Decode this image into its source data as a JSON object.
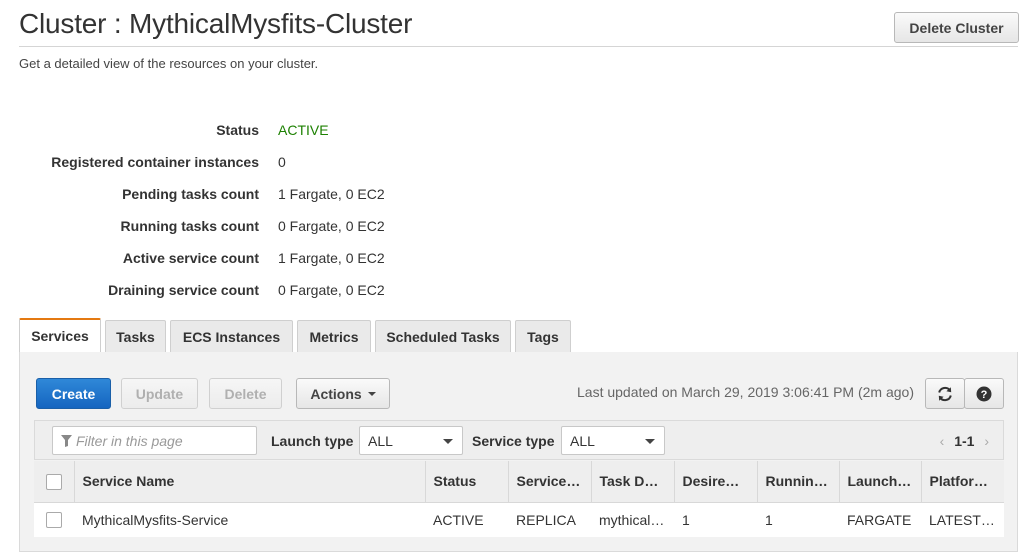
{
  "header": {
    "title": "Cluster : MythicalMysfits-Cluster",
    "subtitle": "Get a detailed view of the resources on your cluster.",
    "delete_button": "Delete Cluster"
  },
  "details": [
    {
      "label": "Status",
      "value": "ACTIVE"
    },
    {
      "label": "Registered container instances",
      "value": "0"
    },
    {
      "label": "Pending tasks count",
      "value": "1 Fargate, 0 EC2"
    },
    {
      "label": "Running tasks count",
      "value": "0 Fargate, 0 EC2"
    },
    {
      "label": "Active service count",
      "value": "1 Fargate, 0 EC2"
    },
    {
      "label": "Draining service count",
      "value": "0 Fargate, 0 EC2"
    }
  ],
  "tabs": [
    {
      "label": "Services",
      "selected": true
    },
    {
      "label": "Tasks"
    },
    {
      "label": "ECS Instances"
    },
    {
      "label": "Metrics"
    },
    {
      "label": "Scheduled Tasks"
    },
    {
      "label": "Tags"
    }
  ],
  "toolbar": {
    "create": "Create",
    "update": "Update",
    "delete": "Delete",
    "actions": "Actions",
    "last_updated": "Last updated on March 29, 2019 3:06:41 PM (2m ago)",
    "refresh_icon": "refresh-icon",
    "help_icon": "help-icon"
  },
  "filter": {
    "placeholder": "Filter in this page",
    "launch_type_label": "Launch type",
    "launch_type_value": "ALL",
    "service_type_label": "Service type",
    "service_type_value": "ALL",
    "pager": "1-1"
  },
  "table": {
    "columns": [
      "Service Name",
      "Status",
      "Service…",
      "Task D…",
      "Desire…",
      "Runnin…",
      "Launch…",
      "Platfor…"
    ],
    "rows": [
      [
        "MythicalMysfits-Service",
        "ACTIVE",
        "REPLICA",
        "mythical…",
        "1",
        "1",
        "FARGATE",
        "LATEST…"
      ]
    ]
  },
  "colors": {
    "active_status": "#1d8102",
    "primary_button": "#1565c0",
    "selected_tab_accent": "#e47911",
    "link": "#0b5fb5"
  }
}
